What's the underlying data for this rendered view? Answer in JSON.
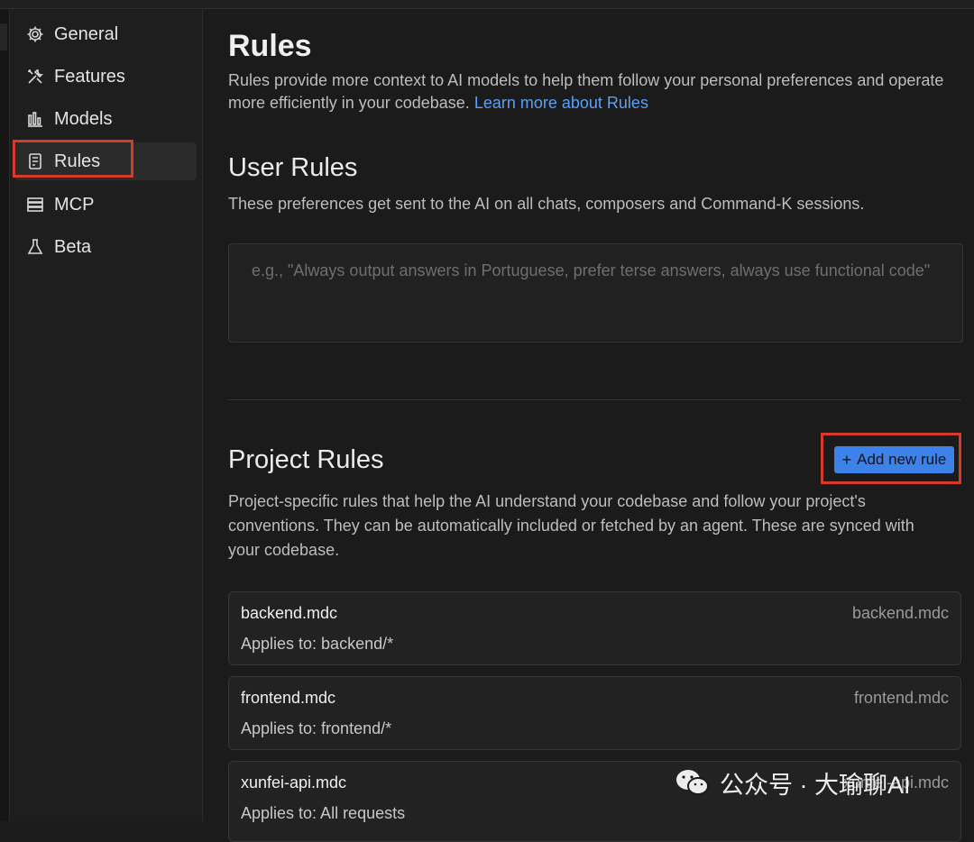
{
  "sidebar": {
    "items": [
      {
        "label": "General",
        "icon": "gear-icon"
      },
      {
        "label": "Features",
        "icon": "tools-icon"
      },
      {
        "label": "Models",
        "icon": "bar-chart-icon"
      },
      {
        "label": "Rules",
        "icon": "document-icon",
        "active": true
      },
      {
        "label": "MCP",
        "icon": "server-icon"
      },
      {
        "label": "Beta",
        "icon": "flask-icon"
      }
    ]
  },
  "main": {
    "title": "Rules",
    "intro_text": "Rules provide more context to AI models to help them follow your personal preferences and operate more efficiently in your codebase.",
    "intro_link": "Learn more about Rules",
    "user_rules": {
      "title": "User Rules",
      "description": "These preferences get sent to the AI on all chats, composers and Command-K sessions.",
      "placeholder": "e.g., \"Always output answers in Portuguese, prefer terse answers, always use functional code\"",
      "value": ""
    },
    "project_rules": {
      "title": "Project Rules",
      "add_button": "Add new rule",
      "description": "Project-specific rules that help the AI understand your codebase and follow your project's conventions. They can be automatically included or fetched by an agent. These are synced with your codebase.",
      "rules": [
        {
          "name": "backend.mdc",
          "file": "backend.mdc",
          "applies": "Applies to: backend/*"
        },
        {
          "name": "frontend.mdc",
          "file": "frontend.mdc",
          "applies": "Applies to: frontend/*"
        },
        {
          "name": "xunfei-api.mdc",
          "file": "xunfei-api.mdc",
          "applies": "Applies to: All requests"
        }
      ]
    }
  },
  "watermark": {
    "text": "公众号 · 大瑜聊AI",
    "icon": "wechat-icon"
  },
  "colors": {
    "accent": "#3c82e8",
    "link": "#5aa0f6",
    "highlight": "#d63a2b",
    "background": "#1b1b1b"
  }
}
